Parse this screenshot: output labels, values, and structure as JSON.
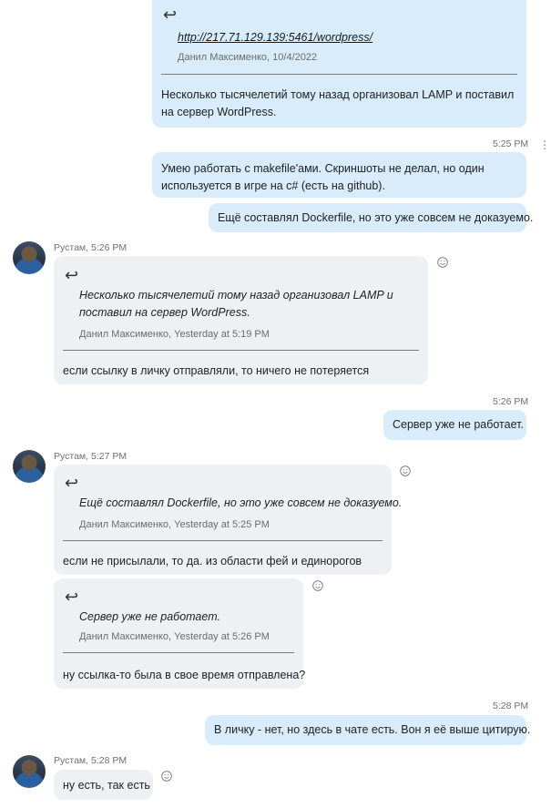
{
  "messages": {
    "m1": {
      "quote_link": "http://217.71.129.139:5461/wordpress/",
      "quote_meta": "Данил Максименко, 10/4/2022",
      "text": "Несколько тысячелетий тому назад организовал LAMP и поставил на сервер WordPress."
    },
    "t1": "5:25 PM",
    "m2": "Умею работать с makefile'ами. Скриншоты не делал, но один используется в игре на c# (есть на github).",
    "m3": "Ещё составлял Dockerfile, но это уже совсем не доказуемо.",
    "s1": "Рустам, 5:26 PM",
    "m4": {
      "quote_text": "Несколько тысячелетий тому назад организовал LAMP и поставил на сервер WordPress.",
      "quote_meta": "Данил Максименко, Yesterday at 5:19 PM",
      "text": "если ссылку в личку отправляли, то ничего не потеряется"
    },
    "t2": "5:26 PM",
    "m5": "Сервер уже не работает.",
    "s2": "Рустам, 5:27 PM",
    "m6": {
      "quote_text": "Ещё составлял Dockerfile, но это уже совсем не доказуемо.",
      "quote_meta": "Данил Максименко, Yesterday at 5:25 PM",
      "text": "если не присылали, то да. из области фей и единорогов"
    },
    "m7": {
      "quote_text": "Сервер уже не работает.",
      "quote_meta": "Данил Максименко, Yesterday at 5:26 PM",
      "text": "ну ссылка-то была в свое время отправлена?"
    },
    "t3": "5:28 PM",
    "m8": "В личку - нет, но здесь в чате есть. Вон я её выше цитирую.",
    "s3": "Рустам, 5:28 PM",
    "m9": "ну есть, так есть"
  },
  "icons": {
    "reply": "reply-arrow-icon",
    "reaction": "smiley-reaction-icon",
    "more": "more-options-icon"
  }
}
